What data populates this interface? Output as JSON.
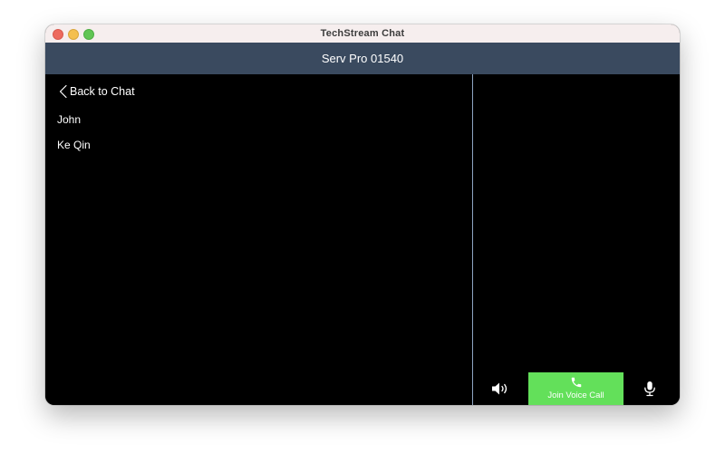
{
  "window": {
    "title": "TechStream Chat"
  },
  "header": {
    "title": "Serv Pro 01540"
  },
  "sidebar": {
    "back_label": "Back to Chat",
    "participants": [
      {
        "name": "John"
      },
      {
        "name": "Ke Qin"
      }
    ]
  },
  "call_controls": {
    "speaker_icon": "speaker-icon",
    "join_label": "Join Voice Call",
    "join_icon": "phone-icon",
    "mic_icon": "microphone-icon",
    "join_color": "#63e05a"
  },
  "colors": {
    "header_bg": "#3a4a5f",
    "background": "#000000",
    "divider": "#8fa6c3"
  }
}
